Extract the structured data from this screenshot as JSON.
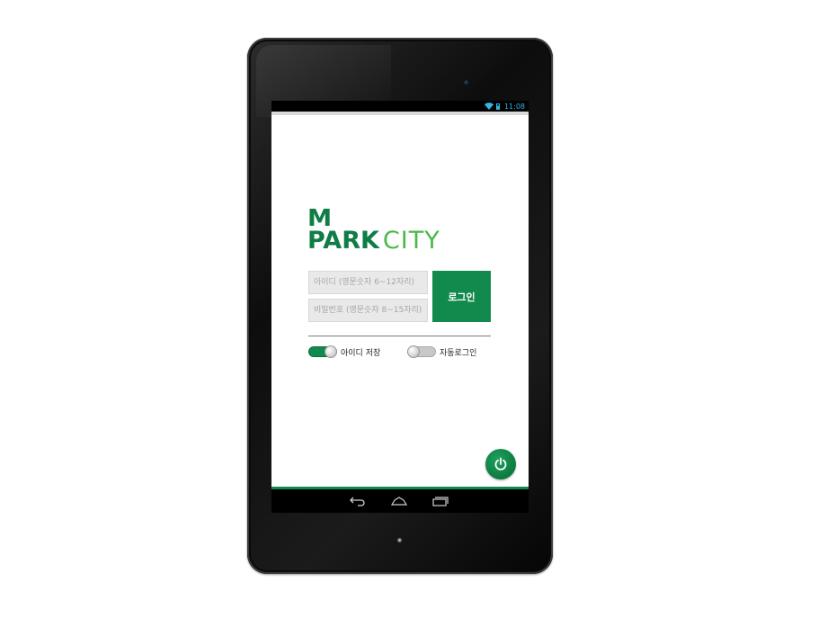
{
  "status_bar": {
    "time": "11:08",
    "icons": [
      "wifi-icon",
      "battery-icon"
    ],
    "accent_color": "#33b5e5"
  },
  "logo": {
    "line1": "M",
    "line2_bold": "PARK",
    "line2_light": "CITY",
    "colors": {
      "dark": "#0f7d45",
      "light": "#4bb848"
    }
  },
  "login": {
    "id_placeholder": "아이디 (영문숫자 6~12자리)",
    "password_placeholder": "비밀번호 (영문숫자 8~15자리)",
    "login_button": "로그인",
    "button_color": "#128a4d"
  },
  "options": {
    "save_id": {
      "label": "아이디 저장",
      "checked": true
    },
    "auto_login": {
      "label": "자동로그인",
      "checked": false
    }
  },
  "power_button": {
    "icon": "power-icon"
  },
  "nav_bar": {
    "icons": [
      "back-icon",
      "home-icon",
      "recent-apps-icon"
    ]
  }
}
